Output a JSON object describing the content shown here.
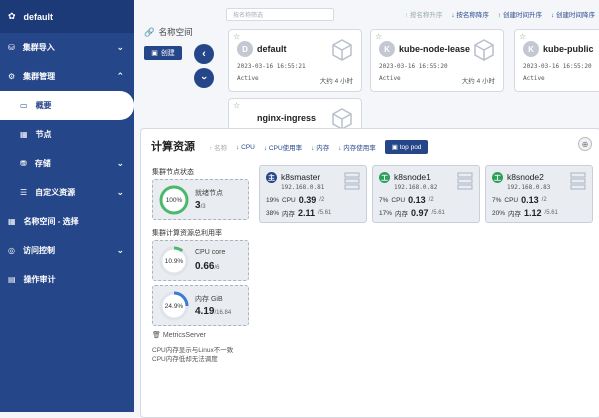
{
  "sidebar": {
    "title": "default",
    "items": [
      {
        "label": "集群导入",
        "icon": "import-icon",
        "chevron": "⌄"
      },
      {
        "label": "集群管理",
        "icon": "cluster-icon",
        "chevron": "⌃"
      },
      {
        "label": "概要",
        "icon": "monitor-icon",
        "chevron": ""
      },
      {
        "label": "节点",
        "icon": "grid-icon",
        "chevron": ""
      },
      {
        "label": "存储",
        "icon": "database-icon",
        "chevron": "⌄"
      },
      {
        "label": "自定义资源",
        "icon": "sliders-icon",
        "chevron": "⌄"
      },
      {
        "label": "名称空间 - 选择",
        "icon": "apps-icon",
        "chevron": ""
      },
      {
        "label": "访问控制",
        "icon": "globe-icon",
        "chevron": "⌄"
      },
      {
        "label": "操作审计",
        "icon": "audit-icon",
        "chevron": ""
      }
    ]
  },
  "topbar": {
    "search_placeholder": "按名称筛选",
    "sort": [
      "按名称升序",
      "按名称降序",
      "创建时间升序",
      "创建时间降序"
    ]
  },
  "namespace": {
    "label": "名称空间",
    "create": "创建",
    "prev": "‹",
    "next": "›",
    "cards": [
      {
        "initial": "D",
        "name": "default",
        "created": "2023-03-16 16:55:21",
        "status": "Active",
        "age": "大约 4 小时"
      },
      {
        "initial": "K",
        "name": "kube-node-lease",
        "created": "2023-03-16 16:55:20",
        "status": "Active",
        "age": "大约 4 小时"
      },
      {
        "initial": "K",
        "name": "kube-public",
        "created": "2023-03-16 16:55:20",
        "status": "Active",
        "age": ""
      },
      {
        "initial": "",
        "name": "nginx-ingress",
        "created": "",
        "status": "",
        "age": ""
      }
    ]
  },
  "compute": {
    "title": "计算资源",
    "sort": [
      "名称",
      "CPU",
      "CPU使用率",
      "内存",
      "内存使用率",
      "top pod"
    ],
    "node_status_label": "集群节点状态",
    "ready": {
      "percent": "100%",
      "label": "就绪节点",
      "value": "3",
      "total": "/3"
    },
    "usage_label": "集群计算资源总利用率",
    "cpu": {
      "percent": "10.9%",
      "label": "CPU core",
      "value": "0.66",
      "total": "/6"
    },
    "mem": {
      "percent": "24.9%",
      "label": "内存 GiB",
      "value": "4.19",
      "total": "/16.84"
    },
    "metrics_server": "MetricsServer",
    "notes": [
      "CPU内存显示与Linux不一致",
      "CPU内存低却无法调度"
    ],
    "nodes": [
      {
        "badge": "主",
        "badge_color": "#26468a",
        "name": "k8smaster",
        "ip": "192.168.0.81",
        "cpu_pct": "19%",
        "cpu_val": "0.39",
        "cpu_total": "/2",
        "mem_pct": "38%",
        "mem_val": "2.11",
        "mem_total": "/5.61"
      },
      {
        "badge": "工",
        "badge_color": "#2e9e5b",
        "name": "k8snode1",
        "ip": "192.168.0.82",
        "cpu_pct": "7%",
        "cpu_val": "0.13",
        "cpu_total": "/2",
        "mem_pct": "17%",
        "mem_val": "0.97",
        "mem_total": "/5.61"
      },
      {
        "badge": "工",
        "badge_color": "#2e9e5b",
        "name": "k8snode2",
        "ip": "192.168.0.83",
        "cpu_pct": "7%",
        "cpu_val": "0.13",
        "cpu_total": "/2",
        "mem_pct": "20%",
        "mem_val": "1.12",
        "mem_total": "/5.61"
      }
    ],
    "cpu_label": "CPU",
    "mem_label": "内存"
  }
}
